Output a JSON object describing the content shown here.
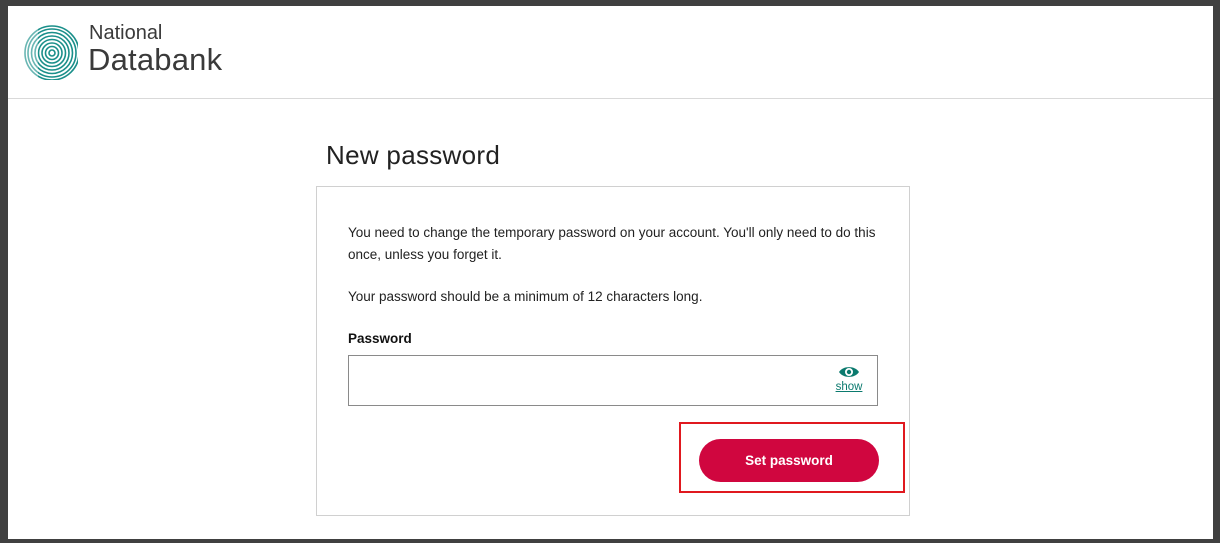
{
  "brand": {
    "line1": "National",
    "line2": "Databank",
    "logo_icon": "fingerprint-icon"
  },
  "page": {
    "title": "New password"
  },
  "form": {
    "intro": "You need to change the temporary password on your account. You'll only need to do this once, unless you forget it.",
    "requirement": "Your password should be a minimum of 12 characters long.",
    "password_label": "Password",
    "password_value": "",
    "show_label": "show",
    "show_icon": "eye-icon",
    "submit_label": "Set password"
  },
  "colors": {
    "accent": "#d0063f",
    "link": "#0b7a6e",
    "logo": "#1a8f8a",
    "highlight": "#e0191f"
  }
}
